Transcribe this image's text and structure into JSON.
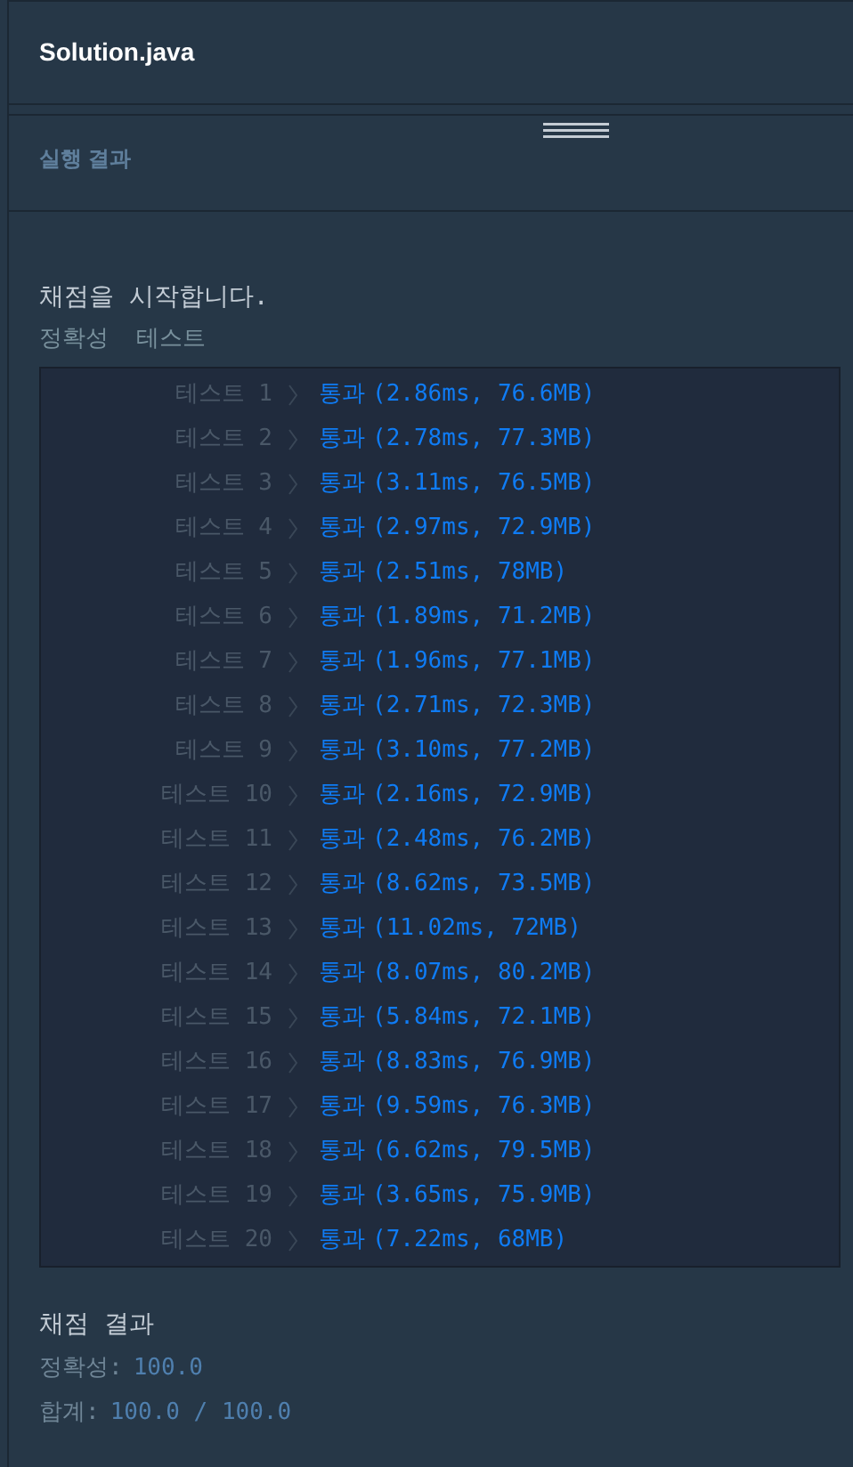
{
  "file_tab": {
    "title": "Solution.java"
  },
  "result_panel": {
    "title": "실행 결과"
  },
  "console": {
    "intro": "채점을 시작합니다.",
    "section_label": "정확성  테스트",
    "tests": [
      {
        "label": "테스트 1",
        "status": "통과",
        "detail": "(2.86ms, 76.6MB)"
      },
      {
        "label": "테스트 2",
        "status": "통과",
        "detail": "(2.78ms, 77.3MB)"
      },
      {
        "label": "테스트 3",
        "status": "통과",
        "detail": "(3.11ms, 76.5MB)"
      },
      {
        "label": "테스트 4",
        "status": "통과",
        "detail": "(2.97ms, 72.9MB)"
      },
      {
        "label": "테스트 5",
        "status": "통과",
        "detail": "(2.51ms, 78MB)"
      },
      {
        "label": "테스트 6",
        "status": "통과",
        "detail": "(1.89ms, 71.2MB)"
      },
      {
        "label": "테스트 7",
        "status": "통과",
        "detail": "(1.96ms, 77.1MB)"
      },
      {
        "label": "테스트 8",
        "status": "통과",
        "detail": "(2.71ms, 72.3MB)"
      },
      {
        "label": "테스트 9",
        "status": "통과",
        "detail": "(3.10ms, 77.2MB)"
      },
      {
        "label": "테스트 10",
        "status": "통과",
        "detail": "(2.16ms, 72.9MB)"
      },
      {
        "label": "테스트 11",
        "status": "통과",
        "detail": "(2.48ms, 76.2MB)"
      },
      {
        "label": "테스트 12",
        "status": "통과",
        "detail": "(8.62ms, 73.5MB)"
      },
      {
        "label": "테스트 13",
        "status": "통과",
        "detail": "(11.02ms, 72MB)"
      },
      {
        "label": "테스트 14",
        "status": "통과",
        "detail": "(8.07ms, 80.2MB)"
      },
      {
        "label": "테스트 15",
        "status": "통과",
        "detail": "(5.84ms, 72.1MB)"
      },
      {
        "label": "테스트 16",
        "status": "통과",
        "detail": "(8.83ms, 76.9MB)"
      },
      {
        "label": "테스트 17",
        "status": "통과",
        "detail": "(9.59ms, 76.3MB)"
      },
      {
        "label": "테스트 18",
        "status": "통과",
        "detail": "(6.62ms, 79.5MB)"
      },
      {
        "label": "테스트 19",
        "status": "통과",
        "detail": "(3.65ms, 75.9MB)"
      },
      {
        "label": "테스트 20",
        "status": "통과",
        "detail": "(7.22ms, 68MB)"
      }
    ],
    "summary_title": "채점 결과",
    "summary": [
      {
        "label": "정확성:",
        "value": "100.0"
      },
      {
        "label": "합계:",
        "value": "100.0 / 100.0"
      }
    ]
  }
}
